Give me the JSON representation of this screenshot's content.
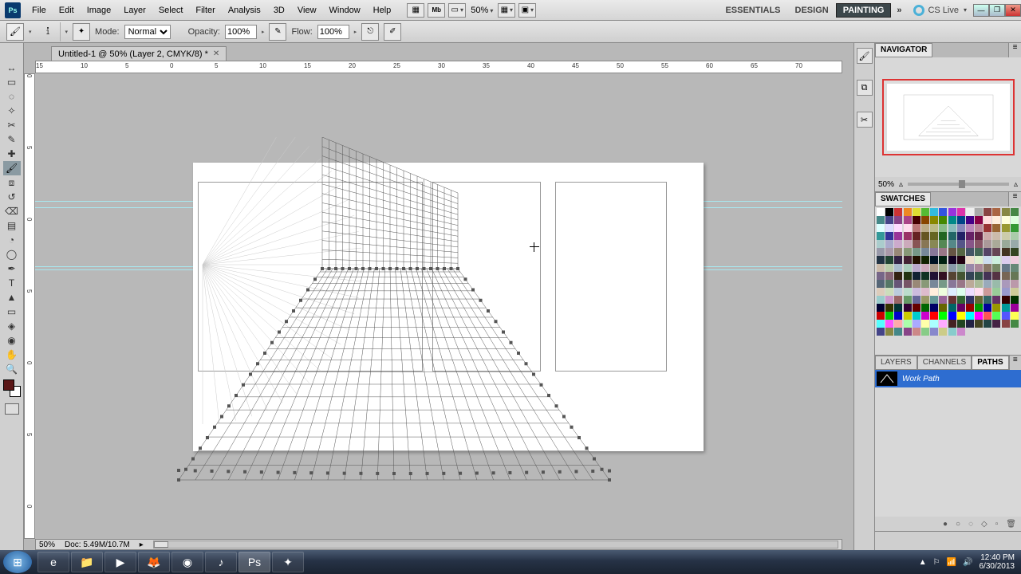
{
  "menu": {
    "items": [
      "File",
      "Edit",
      "Image",
      "Layer",
      "Select",
      "Filter",
      "Analysis",
      "3D",
      "View",
      "Window",
      "Help"
    ],
    "zoom": "50%",
    "workspaces": [
      "ESSENTIALS",
      "DESIGN",
      "PAINTING"
    ],
    "active_ws": "PAINTING",
    "cslive": "CS Live"
  },
  "options": {
    "mode_label": "Mode:",
    "mode": "Normal",
    "opacity_label": "Opacity:",
    "opacity": "100%",
    "flow_label": "Flow:",
    "flow": "100%",
    "brush_size": "1"
  },
  "doc": {
    "tab": "Untitled-1 @ 50% (Layer 2, CMYK/8) *"
  },
  "ruler_h": [
    "15",
    "10",
    "5",
    "0",
    "5",
    "10",
    "15",
    "20",
    "25",
    "30",
    "35",
    "40",
    "45",
    "50",
    "55",
    "60",
    "65",
    "70"
  ],
  "ruler_v": [
    "0",
    "5",
    "0",
    "5",
    "0",
    "5",
    "0"
  ],
  "status": {
    "zoom": "50%",
    "doc": "Doc: 5.49M/10.7M"
  },
  "panels": {
    "navigator": {
      "tab": "NAVIGATOR",
      "zoom": "50%"
    },
    "swatches": {
      "tab": "SWATCHES"
    },
    "layers_tabs": [
      "LAYERS",
      "CHANNELS",
      "PATHS"
    ],
    "active_tab": "PATHS",
    "path_name": "Work Path"
  },
  "swatch_colors": [
    "#fff",
    "#000",
    "#c33",
    "#e82",
    "#dd3",
    "#5b3",
    "#3bd",
    "#35d",
    "#93d",
    "#d3a",
    "#eee",
    "#aaa",
    "#844",
    "#a64",
    "#884",
    "#484",
    "#488",
    "#448",
    "#848",
    "#a48",
    "#400",
    "#840",
    "#880",
    "#480",
    "#088",
    "#048",
    "#408",
    "#804",
    "#fdd",
    "#fed",
    "#ffd",
    "#dfd",
    "#dff",
    "#ddf",
    "#fdf",
    "#fde",
    "#b77",
    "#ba8",
    "#bb8",
    "#8b8",
    "#8bb",
    "#88b",
    "#b8b",
    "#b89",
    "#933",
    "#963",
    "#993",
    "#393",
    "#399",
    "#339",
    "#939",
    "#936",
    "#622",
    "#652",
    "#662",
    "#262",
    "#266",
    "#226",
    "#626",
    "#624",
    "#caa",
    "#cba",
    "#cca",
    "#aca",
    "#acc",
    "#aac",
    "#cac",
    "#cab",
    "#855",
    "#875",
    "#885",
    "#585",
    "#588",
    "#558",
    "#858",
    "#856",
    "#a99",
    "#aa9",
    "#9a9",
    "#9aa",
    "#99a",
    "#a9a",
    "#987",
    "#897",
    "#798",
    "#789",
    "#879",
    "#978",
    "#654",
    "#564",
    "#456",
    "#465",
    "#546",
    "#645",
    "#432",
    "#342",
    "#234",
    "#243",
    "#324",
    "#423",
    "#210",
    "#120",
    "#012",
    "#021",
    "#102",
    "#201",
    "#edc",
    "#dec",
    "#cde",
    "#ced",
    "#dce",
    "#ecd",
    "#cba",
    "#bca",
    "#abc",
    "#acb",
    "#bac",
    "#cab",
    "#a98",
    "#9a8",
    "#89a",
    "#8a9",
    "#98a",
    "#a89",
    "#876",
    "#786",
    "#678",
    "#687",
    "#768",
    "#867",
    "#321",
    "#231",
    "#123",
    "#132",
    "#213",
    "#312",
    "#543",
    "#453",
    "#345",
    "#354",
    "#435",
    "#534",
    "#765",
    "#675",
    "#567",
    "#576",
    "#657",
    "#756",
    "#987",
    "#897",
    "#789",
    "#798",
    "#879",
    "#978",
    "#ba9",
    "#ab9",
    "#9ab",
    "#9ba",
    "#a9b",
    "#b9a",
    "#dcb",
    "#cdb",
    "#bcd",
    "#bdc",
    "#cbd",
    "#dbc",
    "#fed",
    "#efd",
    "#def",
    "#dfe",
    "#edf",
    "#fde",
    "#c99",
    "#9c9",
    "#99c",
    "#cc9",
    "#9cc",
    "#c9c",
    "#966",
    "#696",
    "#669",
    "#996",
    "#699",
    "#969",
    "#633",
    "#363",
    "#336",
    "#663",
    "#366",
    "#636",
    "#300",
    "#030",
    "#003",
    "#330",
    "#033",
    "#303",
    "#600",
    "#060",
    "#006",
    "#660",
    "#066",
    "#606",
    "#900",
    "#090",
    "#009",
    "#990",
    "#099",
    "#909",
    "#c00",
    "#0c0",
    "#00c",
    "#cc0",
    "#0cc",
    "#c0c",
    "#f00",
    "#0f0",
    "#00f",
    "#ff0",
    "#0ff",
    "#f0f",
    "#f55",
    "#5f5",
    "#55f",
    "#ff5",
    "#5ff",
    "#f5f",
    "#faa",
    "#afa",
    "#aaf",
    "#ffa",
    "#aff",
    "#faf",
    "#422",
    "#242",
    "#224",
    "#442",
    "#244",
    "#424",
    "#844",
    "#484",
    "#448",
    "#884",
    "#488",
    "#848",
    "#c88",
    "#8c8",
    "#88c",
    "#cc8",
    "#8cc",
    "#c8c"
  ],
  "tray": {
    "time": "12:40 PM",
    "date": "6/30/2013"
  }
}
